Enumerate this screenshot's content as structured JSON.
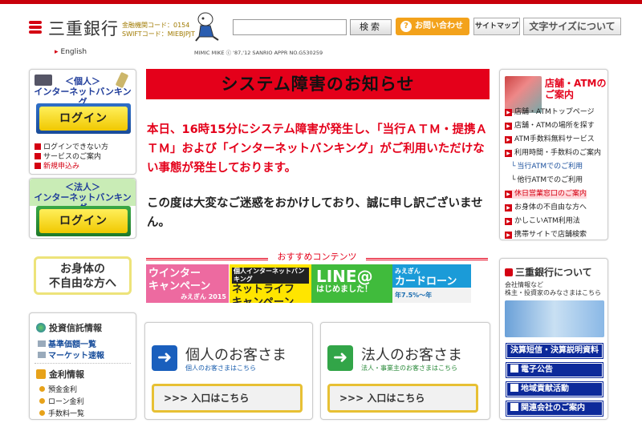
{
  "header": {
    "bank_name": "三重銀行",
    "bank_code": "金融機関コード：0154",
    "swift_code": "SWIFTコード：MIEBJPJT",
    "english_link": "English",
    "mascot_credit": "MIMIC MIKE  ⓒ '87,'12 SANRIO APPR NO.G530259",
    "search_value": "",
    "search_button": "検索",
    "contact_button": "お問い合わせ",
    "contact_icon": "?",
    "sitemap_button": "サイトマップ",
    "fontsize_button": "文字サイズについて",
    "brand_color": "#d40012"
  },
  "left": {
    "personal": {
      "title_line1": "＜個人＞",
      "title_line2": "インターネットバンキング",
      "login": "ログイン",
      "link_cannot_login_1": "ログインできない方",
      "link_cannot_login_2": "サービスのご案内",
      "link_new": "新規申込み"
    },
    "corporate": {
      "title_line1": "＜法人＞",
      "title_line2": "インターネットバンキング",
      "login": "ログイン"
    },
    "disability": {
      "line1": "お身体の",
      "line2": "不自由な方へ"
    },
    "invest": {
      "title": "投資信託情報",
      "link1": "基準価額一覧",
      "link2": "マーケット速報"
    },
    "rates": {
      "title": "金利情報",
      "items": [
        "預金金利",
        "ローン金利",
        "手数料一覧"
      ]
    }
  },
  "notice": {
    "title": "システム障害のお知らせ",
    "body": "本日、16時15分にシステム障害が発生し、「当行ＡＴＭ・提携ＡＴＭ」および「インターネットバンキング」がご利用いただけない事態が発生しております。",
    "apology": "この度は大変なご迷惑をおかけしており、誠に申し訳ございません。"
  },
  "recommended": {
    "title": "おすすめコンテンツ",
    "banners": [
      {
        "line1": "ウインター",
        "line2": "キャンペーン",
        "sub": "みえぎん 2015"
      },
      {
        "sub": "個人インターネットバンキング",
        "line1": "ネットライフ",
        "line2": "キャンペーン"
      },
      {
        "line1": "LINE@",
        "sub": "はじめました！"
      },
      {
        "sub": "みえぎん",
        "line1": "カードローン",
        "line2": "年7.5%〜年"
      }
    ]
  },
  "customers": {
    "individual": {
      "title": "個人のお客さま",
      "sub": "個人のお客さまはこちら",
      "enter": ">>> 入口はこちら",
      "arrow": "➜"
    },
    "corporate": {
      "title": "法人のお客さま",
      "sub": "法人・事業主のお客さまはこちら",
      "enter": ">>> 入口はこちら",
      "arrow": "➜"
    }
  },
  "branch": {
    "title": "店舗・ATMのご案内",
    "links": [
      "店舗・ATMトップページ",
      "店舗・ATMの場所を探す",
      "ATM手数料無料サービス",
      "利用時間・手数料のご案内"
    ],
    "sublinks": [
      "当行ATMでのご利用",
      "他行ATMでのご利用"
    ],
    "links2": [
      "休日営業窓口のご案内",
      "お身体の不自由な方へ",
      "かしこいATM利用法",
      "携帯サイトで店舗検索"
    ]
  },
  "about": {
    "title": "三重銀行について",
    "desc_line1": "会社情報など",
    "desc_line2": "株主・投資家のみなさまはこちら",
    "links": [
      "決算短信・決算説明資料",
      "電子公告",
      "地域貢献活動",
      "関連会社のご案内"
    ]
  }
}
